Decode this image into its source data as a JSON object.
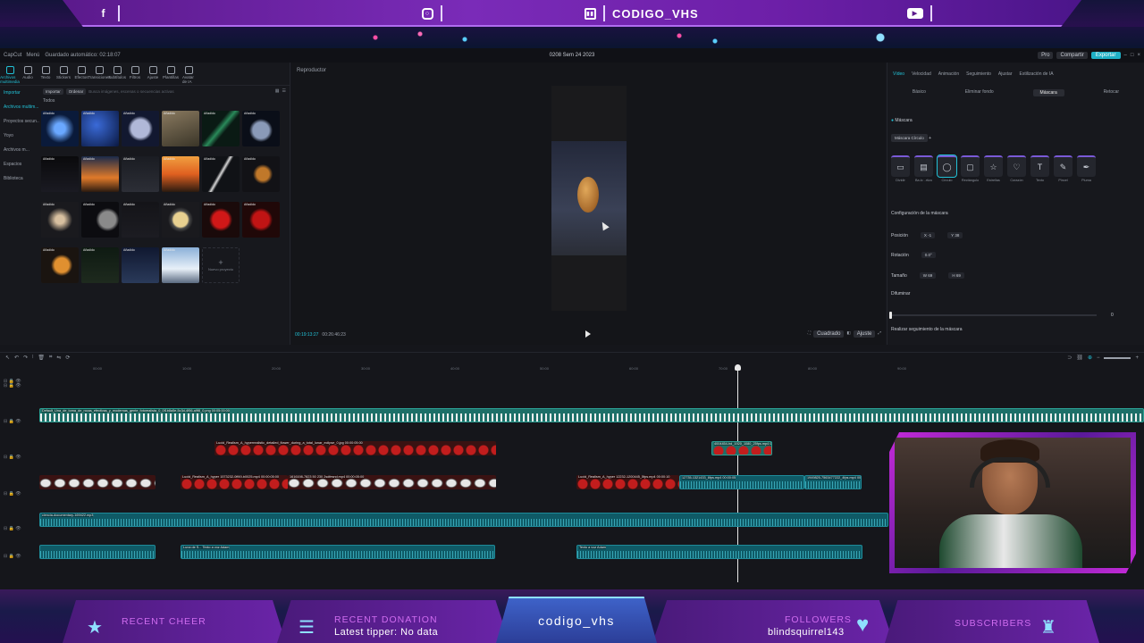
{
  "overlay_top": {
    "channel_name": "CODIGO_VHS",
    "icons": [
      "facebook-icon",
      "instagram-icon",
      "twitch-icon",
      "youtube-icon"
    ]
  },
  "overlay_bottom": {
    "recent_cheer_label": "RECENT CHEER",
    "recent_donation_label": "RECENT DONATION",
    "latest_tipper": "Latest tipper: No data",
    "center_name": "codigo_vhs",
    "followers_label": "FOLLOWERS",
    "followers_value": "blindsquirrel143",
    "subscribers_label": "SUBSCRIBERS"
  },
  "app": {
    "app_name": "CapCut",
    "menu": "Menú",
    "autosave": "Guardado automático: 02:18:07",
    "project_title": "0208 Sem 24 2023",
    "pro_label": "Pro",
    "share_label": "Compartir",
    "export_label": "Exportar"
  },
  "media": {
    "tools": [
      "Archivos multimedia",
      "Audio",
      "Texto",
      "Stickers",
      "Efectos",
      "Transiciones",
      "Subtítulos",
      "Filtros",
      "Ajuste",
      "Plantillas",
      "Avatar de IA"
    ],
    "side": [
      "Importar",
      "Archivos multim...",
      "Proyectos secun...",
      "Yoyo",
      "Archivos m...",
      "Espacios",
      "Biblioteca"
    ],
    "import_btn": "Importar",
    "filter_btn": "Ordenar",
    "search_placeholder": "Busca imágenes, escenas o secuencias activas",
    "all_label": "Todos",
    "added": "Añadido",
    "add_tile": "Nuevo proyecto"
  },
  "player": {
    "label": "Reproductor",
    "current_time": "00:19:13:27",
    "total_time": "00:26:46:23",
    "ratio_btn": "Cuadrado",
    "ctrl": "Ajuste"
  },
  "props": {
    "tabs": [
      "Vídeo",
      "Velocidad",
      "Animación",
      "Seguimiento",
      "Ajustar",
      "Estilización de IA"
    ],
    "subtabs": [
      "Básico",
      "Eliminar fondo",
      "Máscara",
      "Retocar"
    ],
    "mask_title": "Máscara",
    "mask_chip": "Máscara Círculo",
    "masks": [
      "Dividir",
      "Ba.lo ..rtizo",
      "Círculo",
      "Rectángulo",
      "Estrellas",
      "Corazón",
      "Texto",
      "Pincel",
      "Pluma"
    ],
    "config_title": "Configuración de la máscara",
    "position_label": "Posición",
    "position_x": "X  -1",
    "position_y": "Y  38",
    "rotation_label": "Rotación",
    "rotation_value": "0.0°",
    "size_label": "Tamaño",
    "size_w": "W  69",
    "size_h": "H  69",
    "blur_label": "Difuminar",
    "blur_value": "0",
    "tracking_note": "Realizar seguimiento de la máscara"
  },
  "timeline": {
    "ticks": [
      "00:00",
      "10:00",
      "20:00",
      "30:00",
      "40:00",
      "50:00",
      "60:00",
      "70:00",
      "80:00",
      "90:00"
    ],
    "clip_top": "Default_Una_de_toma_de_rocas_efectivas_y_modernas_gente_fotorealista_0_0f1b8a5e-5c3d-4f56-a9f8_0.png  00:05:00:00",
    "clip_red": "Lucid_Realism_A_hyperrealistic_detailed_flower_during_a_total_lunar_eclipse_0.jpg 00:00:05:00",
    "clip_small": "4004454-hd_1920_1080_25fps.mp4 00:00:10",
    "clip_moons_a": "Lucid_Realism_A_hyper 1573232-0ff49-b0025.mp4  00:00:05:00",
    "clip_moons_b": "1616198-7823 50 230 2sdfesnd.mp4  00:00:05:00",
    "clip_right_a": "Lucid_Realism_A_hyper 12232-1200445_5fps.mp4 00:00:10",
    "clip_right_b": "12735-1321433_6fps.mp4  00:00:05",
    "clip_right_c": "1949825-7563477222_4fps.mp4  00:00:10",
    "audio_main": "ciencia-documentary-169422.mp3",
    "audio_a": "Luna de S...  Texto a voz Adam",
    "audio_b": "Texto a voz Adam"
  }
}
